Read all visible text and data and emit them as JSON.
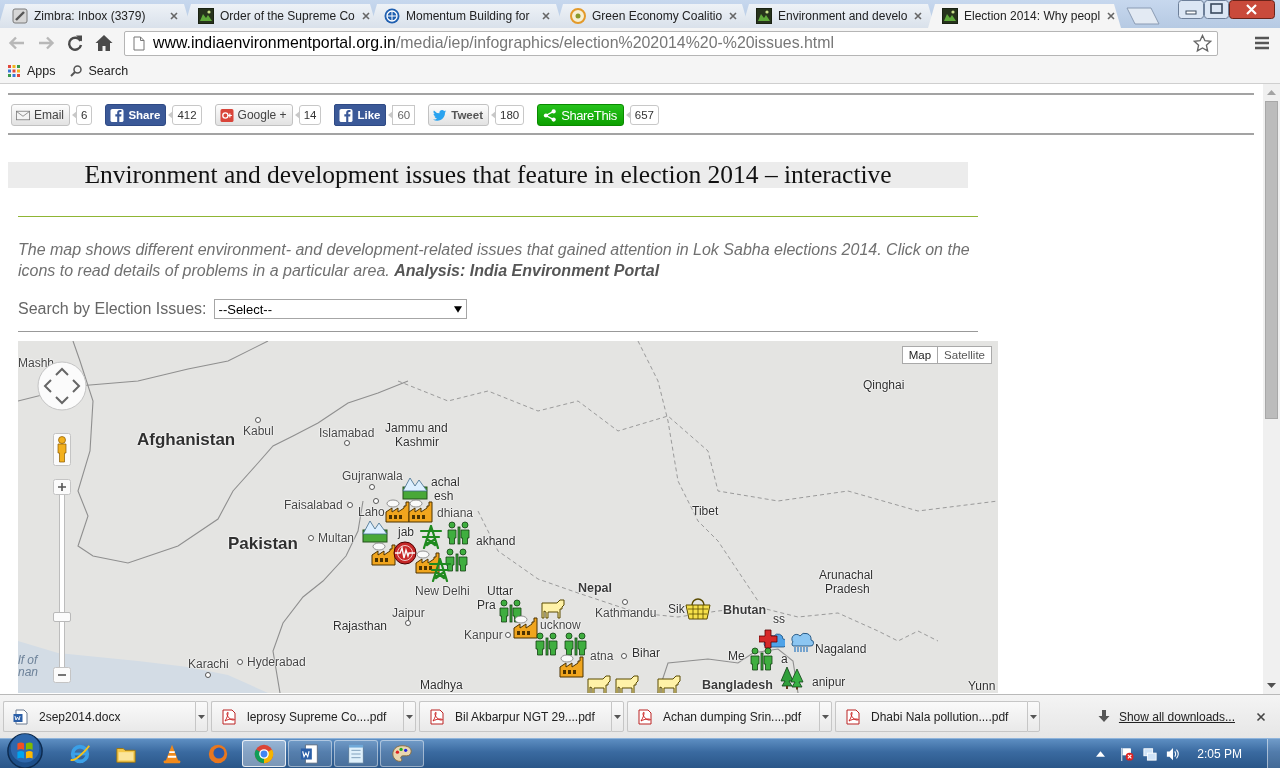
{
  "browser": {
    "tabs": [
      {
        "title": "Zimbra: Inbox (3379)",
        "kind": "zimbra",
        "selected": false
      },
      {
        "title": "Order of the Supreme Co",
        "kind": "portal",
        "selected": false
      },
      {
        "title": "Momentum Building for",
        "kind": "globe",
        "selected": false
      },
      {
        "title": "Green Economy Coalitio",
        "kind": "badge",
        "selected": false
      },
      {
        "title": "Environment and develo",
        "kind": "portal",
        "selected": false
      },
      {
        "title": "Election 2014: Why peopl",
        "kind": "portal",
        "selected": true
      }
    ],
    "navigation": [
      {
        "kind": "back",
        "disabled": true
      },
      {
        "kind": "forward",
        "disabled": true
      },
      {
        "kind": "reload",
        "disabled": false
      },
      {
        "kind": "home",
        "disabled": false
      }
    ],
    "url": {
      "host": "www.indiaenvironmentportal.org.in",
      "path": "/media/iep/infographics/election%202014%20-%20issues.html"
    },
    "bookmarks": [
      {
        "kind": "apps",
        "label": "Apps"
      },
      {
        "kind": "search",
        "label": "Search"
      }
    ]
  },
  "share_buttons": [
    {
      "kind": "email",
      "label": "Email",
      "count": "6"
    },
    {
      "kind": "facebook",
      "label": "Share",
      "count": "412"
    },
    {
      "kind": "google",
      "label": "Google +",
      "count": "14"
    },
    {
      "kind": "like",
      "label": "Like",
      "count": "60"
    },
    {
      "kind": "twitter",
      "label": "Tweet",
      "count": "180"
    },
    {
      "kind": "sharethis",
      "label": "ShareThis",
      "count": "657"
    }
  ],
  "heading": "Environment and development issues that feature in election 2014 – interactive",
  "intro": "The map shows different environment- and development-related issues that gained attention in Lok Sabha elections 2014. Click on the icons to read details of problems in a particular area. **Analysis: India Environment Portal**",
  "filter": {
    "label": "Search by Election Issues:",
    "value": "--Select--"
  },
  "map": {
    "type_buttons": [
      {
        "label": "Map",
        "selected": true
      },
      {
        "label": "Satellite",
        "selected": false
      }
    ],
    "zoom": {
      "level": 0.28
    },
    "places": [
      {
        "label": "Mashh",
        "kind": "city"
      },
      {
        "label": "Afghanistan",
        "kind": "country"
      },
      {
        "label": "Kabul",
        "kind": "city"
      },
      {
        "label": "Islamabad",
        "kind": "city"
      },
      {
        "label": "Jammu and",
        "kind": "state"
      },
      {
        "label": "Kashmir",
        "kind": "state"
      },
      {
        "label": "Gujranwala",
        "kind": "city"
      },
      {
        "label": "achal",
        "kind": "state"
      },
      {
        "label": "esh",
        "kind": "state"
      },
      {
        "label": "Faisalabad",
        "kind": "city"
      },
      {
        "label": "Laho",
        "kind": "city"
      },
      {
        "label": "jab",
        "kind": "state"
      },
      {
        "label": "dhiana",
        "kind": "city"
      },
      {
        "label": "Pakistan",
        "kind": "country"
      },
      {
        "label": "Multan",
        "kind": "city"
      },
      {
        "label": "akhand",
        "kind": "state"
      },
      {
        "label": "New Delhi",
        "kind": "city"
      },
      {
        "label": "Uttar",
        "kind": "state"
      },
      {
        "label": "Pra",
        "kind": "state"
      },
      {
        "label": "Jaipur",
        "kind": "city"
      },
      {
        "label": "Rajasthan",
        "kind": "state"
      },
      {
        "label": "Kanpur",
        "kind": "city"
      },
      {
        "label": "lf of",
        "kind": "water"
      },
      {
        "label": "nan",
        "kind": "water"
      },
      {
        "label": "Karachi",
        "kind": "city"
      },
      {
        "label": "Hyderabad",
        "kind": "city"
      },
      {
        "label": "Madhya",
        "kind": "state"
      },
      {
        "label": "Qinghai",
        "kind": "state"
      },
      {
        "label": "Tibet",
        "kind": "state"
      },
      {
        "label": "Nepal",
        "kind": "nation"
      },
      {
        "label": "Kathmandu",
        "kind": "city"
      },
      {
        "label": "ucknow",
        "kind": "city"
      },
      {
        "label": "atna",
        "kind": "city"
      },
      {
        "label": "Bihar",
        "kind": "state"
      },
      {
        "label": "Sik",
        "kind": "state"
      },
      {
        "label": "Bhutan",
        "kind": "nation"
      },
      {
        "label": "Arunachal",
        "kind": "state"
      },
      {
        "label": "Pradesh",
        "kind": "state"
      },
      {
        "label": "ss",
        "kind": "state"
      },
      {
        "label": "Nagaland",
        "kind": "state"
      },
      {
        "label": "Me",
        "kind": "state"
      },
      {
        "label": "a",
        "kind": "state"
      },
      {
        "label": "Bangladesh",
        "kind": "nation"
      },
      {
        "label": "anipur",
        "kind": "state"
      },
      {
        "label": "Yunn",
        "kind": "state"
      }
    ],
    "markers": [
      {
        "kind": "mountains"
      },
      {
        "kind": "factory"
      },
      {
        "kind": "factory"
      },
      {
        "kind": "mountains"
      },
      {
        "kind": "pylon"
      },
      {
        "kind": "people"
      },
      {
        "kind": "factory"
      },
      {
        "kind": "seismic"
      },
      {
        "kind": "factory"
      },
      {
        "kind": "people"
      },
      {
        "kind": "pylon"
      },
      {
        "kind": "people"
      },
      {
        "kind": "cow"
      },
      {
        "kind": "factory"
      },
      {
        "kind": "people"
      },
      {
        "kind": "people"
      },
      {
        "kind": "factory"
      },
      {
        "kind": "basket"
      },
      {
        "kind": "medical"
      },
      {
        "kind": "rain"
      },
      {
        "kind": "people"
      },
      {
        "kind": "trees"
      },
      {
        "kind": "cow"
      },
      {
        "kind": "cow"
      },
      {
        "kind": "cow"
      }
    ]
  },
  "downloads": {
    "items": [
      {
        "kind": "docx",
        "name": "2sep2014.docx"
      },
      {
        "kind": "pdf",
        "name": "leprosy Supreme Co....pdf"
      },
      {
        "kind": "pdf",
        "name": "Bil Akbarpur NGT 29....pdf"
      },
      {
        "kind": "pdf",
        "name": "Achan dumping Srin....pdf"
      },
      {
        "kind": "pdf",
        "name": "Dhabi Nala pollution....pdf"
      }
    ],
    "show_all": "Show all downloads..."
  },
  "taskbar": {
    "apps": [
      {
        "kind": "ie",
        "running": false,
        "selected": false
      },
      {
        "kind": "explorer",
        "running": false,
        "selected": false
      },
      {
        "kind": "vlc",
        "running": false,
        "selected": false
      },
      {
        "kind": "firefox",
        "running": false,
        "selected": false
      },
      {
        "kind": "chrome",
        "running": true,
        "selected": true
      },
      {
        "kind": "word",
        "running": true,
        "selected": false
      },
      {
        "kind": "notepad",
        "running": true,
        "selected": false
      },
      {
        "kind": "paint",
        "running": true,
        "selected": false
      }
    ],
    "clock": "2:05 PM"
  }
}
